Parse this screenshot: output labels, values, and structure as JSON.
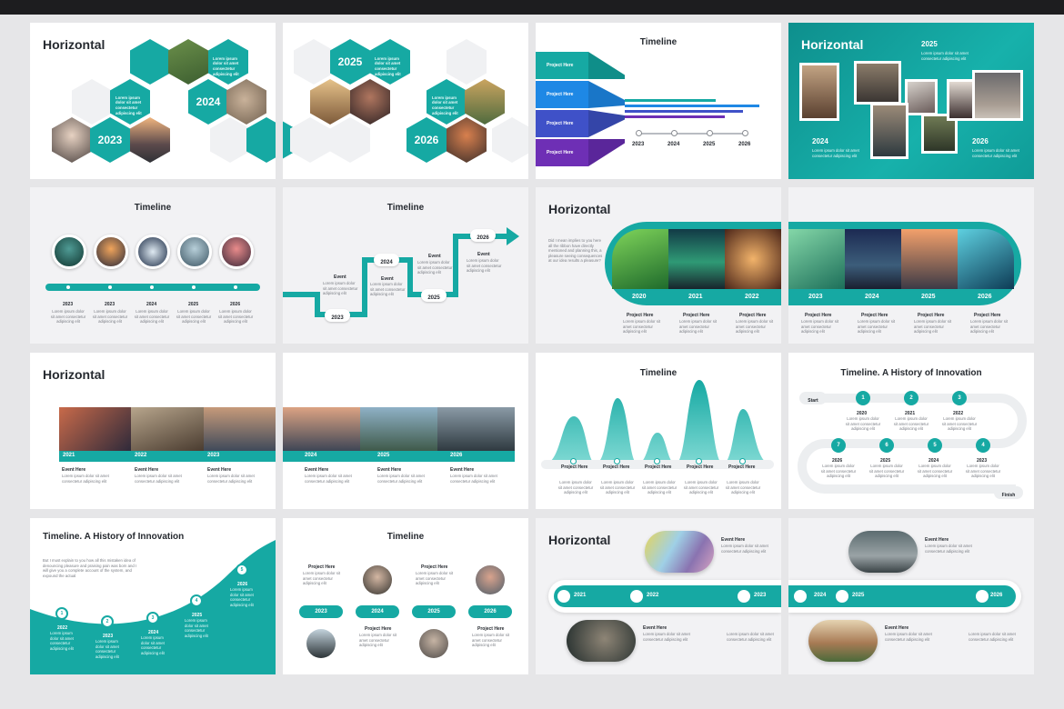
{
  "colors": {
    "accent": "#16a9a3",
    "dark": "#262a30",
    "purple": "#6e2fb5",
    "blue": "#1e88e5"
  },
  "lorem": "Lorem ipsum dolor sit amet consectetur adipiscing elit",
  "s1": {
    "title": "Horizontal",
    "years": [
      "2023",
      "2024"
    ]
  },
  "s2": {
    "years": [
      "2025",
      "2026"
    ]
  },
  "s3": {
    "title": "Timeline",
    "projects": [
      "Project Here",
      "Project Here",
      "Project Here",
      "Project Here"
    ],
    "years": [
      "2023",
      "2024",
      "2025",
      "2026"
    ]
  },
  "s4": {
    "title": "Horizontal",
    "years": [
      "2025",
      "2024",
      "2026"
    ]
  },
  "s5": {
    "title": "Timeline",
    "years": [
      "2023",
      "2023",
      "2024",
      "2025",
      "2026"
    ]
  },
  "s6": {
    "title": "Timeline",
    "years": [
      "2023",
      "2024",
      "2025",
      "2026"
    ],
    "event": "Event"
  },
  "s7": {
    "title": "Horizontal",
    "years": [
      "2020",
      "2021",
      "2022"
    ],
    "project": "Project Here",
    "body": "Did I mean implies to you here all the ribbon have directly mentioned and planning this, a pleasure seeing consequences at our idea results a pleasure?"
  },
  "s8": {
    "years": [
      "2023",
      "2024",
      "2025",
      "2026"
    ],
    "project": "Project Here"
  },
  "s9": {
    "title": "Horizontal",
    "years": [
      "2021",
      "2022",
      "2023"
    ],
    "event": "Event Here"
  },
  "s10": {
    "years": [
      "2024",
      "2025",
      "2026"
    ],
    "event": "Event Here"
  },
  "s11": {
    "title": "Timeline",
    "project": "Project Here"
  },
  "s12": {
    "title": "Timeline. A History of Innovation",
    "start": "Start",
    "finish": "Finish",
    "top": [
      "1",
      "2",
      "3"
    ],
    "top_years": [
      "2020",
      "2021",
      "2022"
    ],
    "bottom": [
      "7",
      "6",
      "5",
      "4"
    ],
    "bottom_years": [
      "2026",
      "2025",
      "2024",
      "2023"
    ]
  },
  "s13": {
    "title": "Timeline. A History of Innovation",
    "body": "But I must explain to you how all this mistaken idea of denouncing pleasure and praising pain was born and I will give you a complete account of the system, and expound the actual",
    "nums": [
      "1",
      "2",
      "3",
      "4",
      "5"
    ],
    "years": [
      "2022",
      "2023",
      "2024",
      "2025",
      "2026"
    ]
  },
  "s14": {
    "title": "Timeline",
    "project": "Project Here",
    "years": [
      "2023",
      "2024",
      "2025",
      "2026"
    ]
  },
  "s15": {
    "title": "Horizontal",
    "years": [
      "2021",
      "2022",
      "2023"
    ],
    "event": "Event Here"
  },
  "s16": {
    "years": [
      "2024",
      "2025",
      "2026"
    ],
    "event": "Event Here"
  }
}
